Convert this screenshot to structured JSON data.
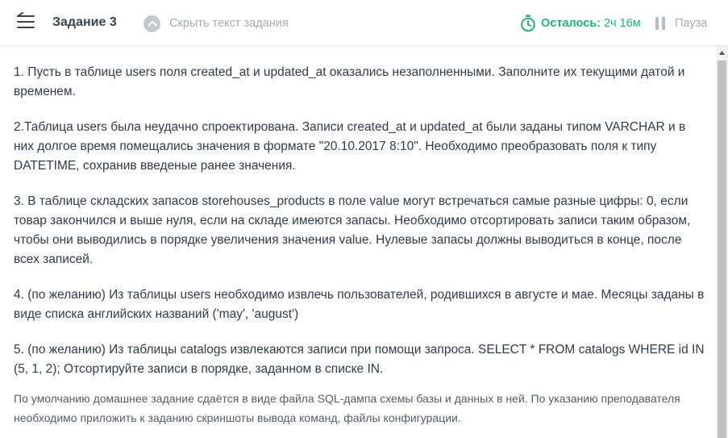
{
  "header": {
    "back_icon": "menu-back-icon",
    "title": "Задание 3",
    "hide_toggle_icon": "chevron-up-icon",
    "hide_toggle_label": "Скрыть текст задания",
    "timer_icon": "stopwatch-icon",
    "timer_label": "Осталось:",
    "timer_value": "2ч 16м",
    "pause_icon": "pause-icon",
    "pause_label": "Пауза",
    "accent_color": "#21b27a"
  },
  "task": {
    "items": [
      "1. Пусть в таблице users поля created_at и updated_at оказались незаполненными. Заполните их текущими датой и временем.",
      "2.Таблица users была неудачно спроектирована. Записи created_at и updated_at были заданы типом VARCHAR и в них долгое время помещались значения в формате \"20.10.2017 8:10\". Необходимо преобразовать поля к типу DATETIME, сохранив введеные ранее значения.",
      "3. В таблице складских запасов storehouses_products в поле value могут встречаться самые разные цифры: 0, если товар закончился и выше нуля, если на складе имеются запасы. Необходимо отсортировать записи таким образом, чтобы они выводились в порядке увеличения значения value. Нулевые запасы должны выводиться в конце, после всех записей.",
      "4. (по желанию) Из таблицы users необходимо извлечь пользователей, родившихся в августе и мае. Месяцы заданы в виде списка английских названий ('may', 'august')",
      "5. (по желанию) Из таблицы catalogs извлекаются записи при помощи запроса. SELECT * FROM catalogs WHERE id IN (5, 1, 2); Отсортируйте записи в порядке, заданном в списке IN."
    ],
    "note": "По умолчанию домашнее задание сдаётся в виде файла SQL-дампа схемы базы и данных в ней. По указанию преподавателя необходимо приложить к заданию скриншоты вывода команд, файлы конфигурации."
  }
}
